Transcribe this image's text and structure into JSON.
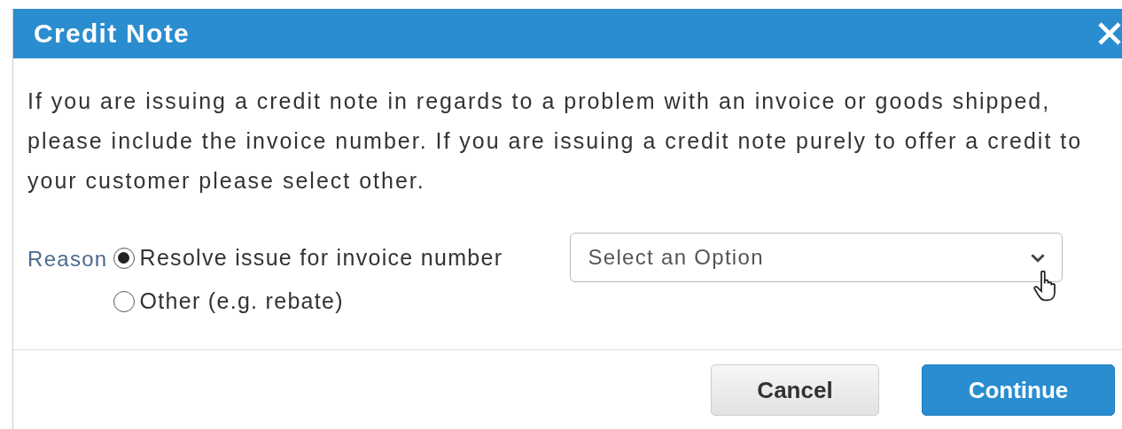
{
  "dialog": {
    "title": "Credit Note",
    "message": "If you are issuing a credit note in regards to a problem with an invoice or goods shipped, please include the invoice number. If you are issuing a credit note purely to offer a credit to your customer please select other.",
    "reason": {
      "label": "Reason",
      "options": [
        {
          "label": "Resolve issue for invoice number",
          "selected": true
        },
        {
          "label": "Other (e.g. rebate)",
          "selected": false
        }
      ]
    },
    "select": {
      "placeholder": "Select an Option"
    },
    "buttons": [
      {
        "label": "Cancel",
        "kind": "secondary"
      },
      {
        "label": "Continue",
        "kind": "primary"
      }
    ]
  }
}
